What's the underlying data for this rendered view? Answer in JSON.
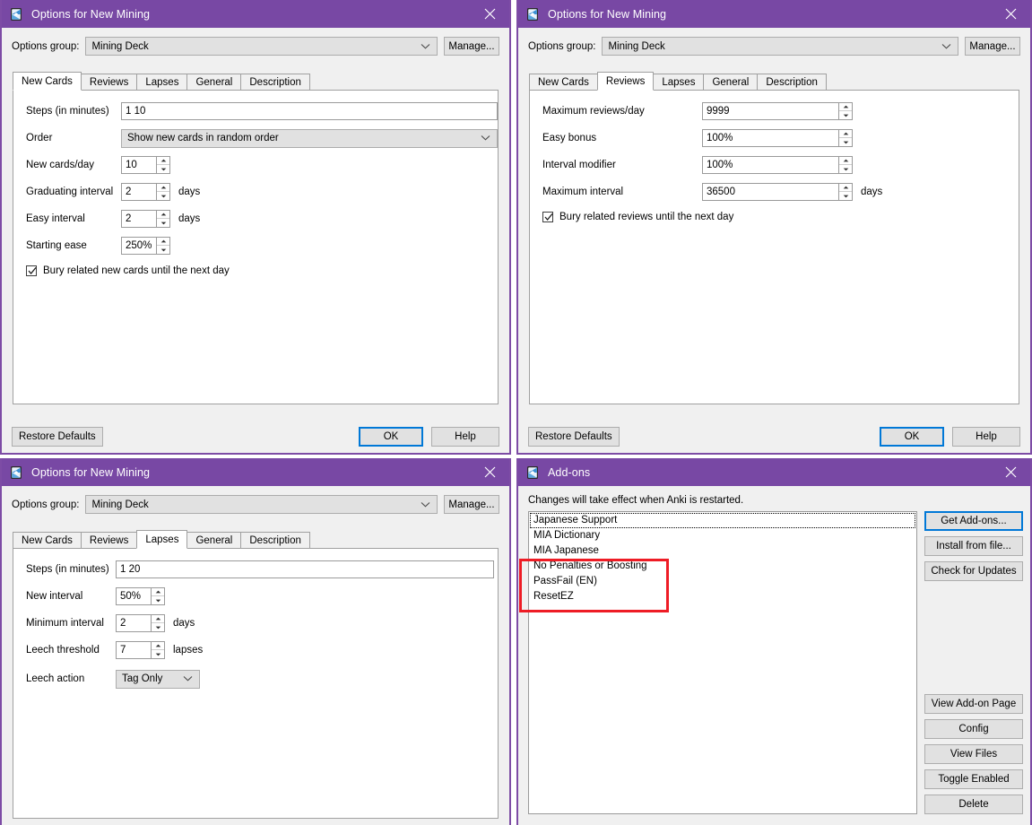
{
  "colors": {
    "titlebar": "#7848a4",
    "window_border": "#7d4ca5",
    "dialog_bg": "#f0f0f0",
    "accent_focus": "#0078d7",
    "annotation": "#ee1c25"
  },
  "icons": {
    "app": "anki-icon",
    "close": "close-icon",
    "caret": "chevron-down-icon",
    "spin_up": "spinner-up-icon",
    "spin_down": "spinner-down-icon",
    "check": "checkmark-icon"
  },
  "dialog_new_cards": {
    "title": "Options for New Mining",
    "options_group_label": "Options group:",
    "options_group_value": "Mining Deck",
    "manage_label": "Manage...",
    "tabs": [
      {
        "label": "New Cards",
        "active": true
      },
      {
        "label": "Reviews",
        "active": false
      },
      {
        "label": "Lapses",
        "active": false
      },
      {
        "label": "General",
        "active": false
      },
      {
        "label": "Description",
        "active": false
      }
    ],
    "fields": {
      "steps_label": "Steps (in minutes)",
      "steps_value": "1 10",
      "order_label": "Order",
      "order_value": "Show new cards in random order",
      "new_cards_day_label": "New cards/day",
      "new_cards_day_value": "10",
      "graduating_label": "Graduating interval",
      "graduating_value": "2",
      "graduating_suffix": "days",
      "easy_label": "Easy interval",
      "easy_value": "2",
      "easy_suffix": "days",
      "starting_ease_label": "Starting ease",
      "starting_ease_value": "250%",
      "bury_label": "Bury related new cards until the next day",
      "bury_checked": true
    },
    "footer": {
      "restore_label": "Restore Defaults",
      "ok_label": "OK",
      "help_label": "Help"
    }
  },
  "dialog_reviews": {
    "title": "Options for New Mining",
    "options_group_label": "Options group:",
    "options_group_value": "Mining Deck",
    "manage_label": "Manage...",
    "tabs": [
      {
        "label": "New Cards",
        "active": false
      },
      {
        "label": "Reviews",
        "active": true
      },
      {
        "label": "Lapses",
        "active": false
      },
      {
        "label": "General",
        "active": false
      },
      {
        "label": "Description",
        "active": false
      }
    ],
    "fields": {
      "max_reviews_label": "Maximum reviews/day",
      "max_reviews_value": "9999",
      "easy_bonus_label": "Easy bonus",
      "easy_bonus_value": "100%",
      "interval_modifier_label": "Interval modifier",
      "interval_modifier_value": "100%",
      "max_interval_label": "Maximum interval",
      "max_interval_value": "36500",
      "max_interval_suffix": "days",
      "bury_label": "Bury related reviews until the next day",
      "bury_checked": true
    },
    "footer": {
      "restore_label": "Restore Defaults",
      "ok_label": "OK",
      "help_label": "Help"
    }
  },
  "dialog_lapses": {
    "title": "Options for New Mining",
    "options_group_label": "Options group:",
    "options_group_value": "Mining Deck",
    "manage_label": "Manage...",
    "tabs": [
      {
        "label": "New Cards",
        "active": false
      },
      {
        "label": "Reviews",
        "active": false
      },
      {
        "label": "Lapses",
        "active": true
      },
      {
        "label": "General",
        "active": false
      },
      {
        "label": "Description",
        "active": false
      }
    ],
    "fields": {
      "steps_label": "Steps (in minutes)",
      "steps_value": "1 20",
      "new_interval_label": "New interval",
      "new_interval_value": "50%",
      "min_interval_label": "Minimum interval",
      "min_interval_value": "2",
      "min_interval_suffix": "days",
      "leech_threshold_label": "Leech threshold",
      "leech_threshold_value": "7",
      "leech_threshold_suffix": "lapses",
      "leech_action_label": "Leech action",
      "leech_action_value": "Tag Only"
    }
  },
  "dialog_addons": {
    "title": "Add-ons",
    "note": "Changes will take effect when Anki is restarted.",
    "items": [
      {
        "label": "Japanese Support",
        "focused": true
      },
      {
        "label": "MIA Dictionary",
        "focused": false
      },
      {
        "label": "MIA Japanese",
        "focused": false
      },
      {
        "label": "No Penalties or Boosting",
        "focused": false
      },
      {
        "label": "PassFail (EN)",
        "focused": false
      },
      {
        "label": "ResetEZ",
        "focused": false
      }
    ],
    "buttons_top": [
      {
        "label": "Get Add-ons...",
        "primary": true
      },
      {
        "label": "Install from file...",
        "primary": false
      },
      {
        "label": "Check for Updates",
        "primary": false
      }
    ],
    "buttons_bottom": [
      {
        "label": "View Add-on Page"
      },
      {
        "label": "Config"
      },
      {
        "label": "View Files"
      },
      {
        "label": "Toggle Enabled"
      },
      {
        "label": "Delete"
      }
    ]
  }
}
